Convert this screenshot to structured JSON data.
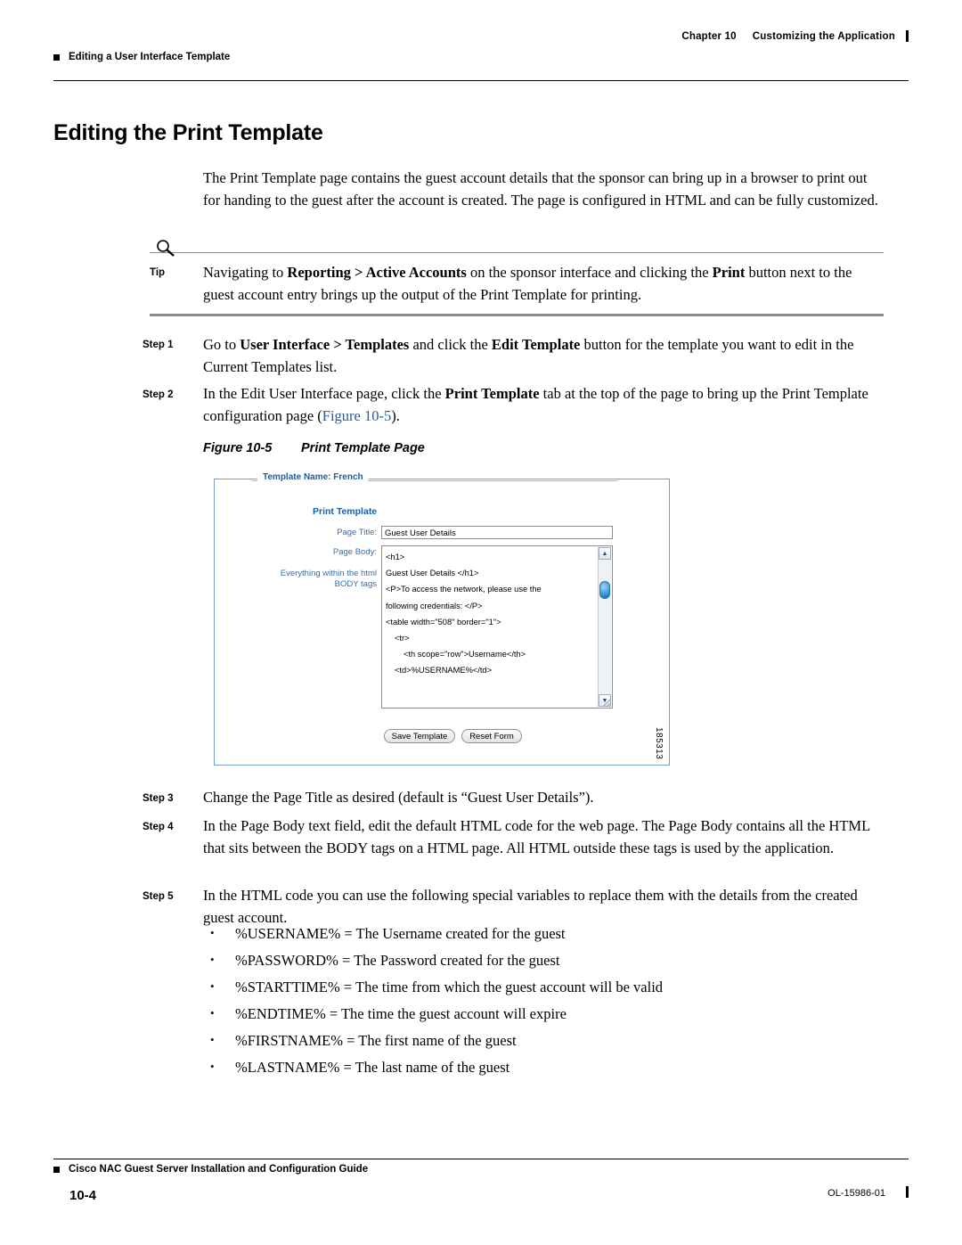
{
  "header": {
    "chapter": "Chapter 10",
    "chapter_title": "Customizing the Application",
    "running_head": "Editing a User Interface Template"
  },
  "title": "Editing the Print Template",
  "intro": "The Print Template page contains the guest account details that the sponsor can bring up in a browser to print out for handing to the guest after the account is created. The page is configured in HTML and can be fully customized.",
  "tip": {
    "label": "Tip",
    "text_1": "Navigating to ",
    "bold_1": "Reporting > Active Accounts",
    "text_2": " on the sponsor interface and clicking the ",
    "bold_2": "Print",
    "text_3": " button next to the guest account entry brings up the output of the Print Template for printing."
  },
  "steps": [
    {
      "label": "Step 1",
      "text_1": "Go to ",
      "bold_1": "User Interface > Templates",
      "text_2": " and click the ",
      "bold_2": "Edit Template",
      "text_3": " button for the template you want to edit in the Current Templates list."
    },
    {
      "label": "Step 2",
      "text_1": "In the Edit User Interface page, click the ",
      "bold_1": "Print Template",
      "text_2": " tab at the top of the page to bring up the Print Template configuration page (",
      "link": "Figure 10-5",
      "text_3": ")."
    },
    {
      "label": "Step 3",
      "text_1": "Change the Page Title as desired (default is “Guest User Details”)."
    },
    {
      "label": "Step 4",
      "text_1": "In the Page Body text field, edit the default HTML code for the web page. The Page Body contains all the HTML that sits between the BODY tags on a HTML page. All HTML outside these tags is used by the application."
    },
    {
      "label": "Step 5",
      "text_1": "In the HTML code you can use the following special variables to replace them with the details from the created guest account."
    }
  ],
  "figure": {
    "caption_num": "Figure 10-5",
    "caption_text": "Print Template Page",
    "template_name": "Template Name: French",
    "section_header": "Print Template",
    "page_title_label": "Page Title:",
    "page_title_value": "Guest User Details",
    "page_body_label": "Page Body:",
    "body_hint_line1": "Everything within the html",
    "body_hint_line2": "BODY tags",
    "body_lines": [
      "<h1>",
      "Guest User Details  </h1>",
      "<P>To access the network, please use the",
      "following credentials: </P>",
      "<table width=\"508\" border=\"1\">",
      "<tr>",
      "<th scope=\"row\">Username</th>",
      "<td>%USERNAME%</td>"
    ],
    "save_button": "Save Template",
    "reset_button": "Reset Form",
    "figure_id": "185313"
  },
  "variables": [
    "%USERNAME% = The Username created for the guest",
    "%PASSWORD% = The Password created for the guest",
    "%STARTTIME% = The time from which the guest account will be valid",
    "%ENDTIME% = The time the guest account will expire",
    "%FIRSTNAME% = The first name of the guest",
    "%LASTNAME% = The last name of the guest"
  ],
  "footer": {
    "book_title": "Cisco NAC Guest Server Installation and Configuration Guide",
    "page_number": "10-4",
    "doc_id": "OL-15986-01"
  }
}
